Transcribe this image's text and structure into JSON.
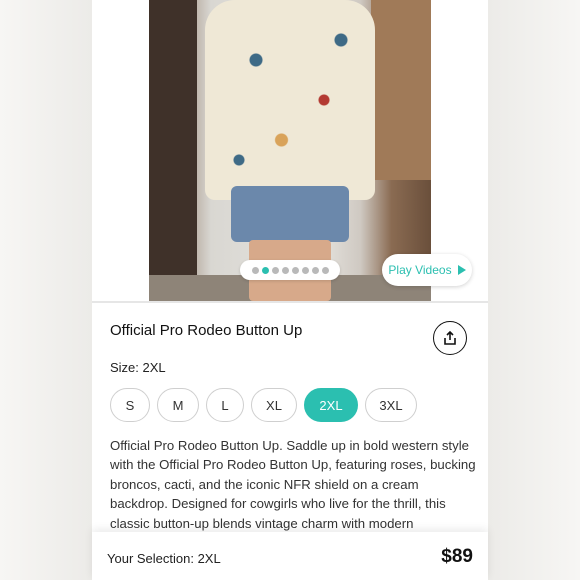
{
  "product": {
    "title": "Official Pro Rodeo Button Up",
    "description": "Official Pro Rodeo Button Up. Saddle up in bold western style with the Official Pro Rodeo Button Up, featuring roses, bucking broncos, cacti, and the iconic NFR shield on a cream backdrop. Designed for cowgirls who live for the thrill, this classic button-up blends vintage charm with modern"
  },
  "gallery": {
    "image_count": 8,
    "active_index": 1,
    "play_videos_label": "Play Videos"
  },
  "size": {
    "label": "Size: 2XL",
    "options": [
      "S",
      "M",
      "L",
      "XL",
      "2XL",
      "3XL"
    ],
    "selected": "2XL"
  },
  "footer": {
    "selection_text": "Your Selection: 2XL",
    "price": "$89"
  },
  "colors": {
    "accent": "#2bbfb0",
    "text": "#111111"
  },
  "icons": {
    "share": "share-icon",
    "play": "play-icon"
  }
}
